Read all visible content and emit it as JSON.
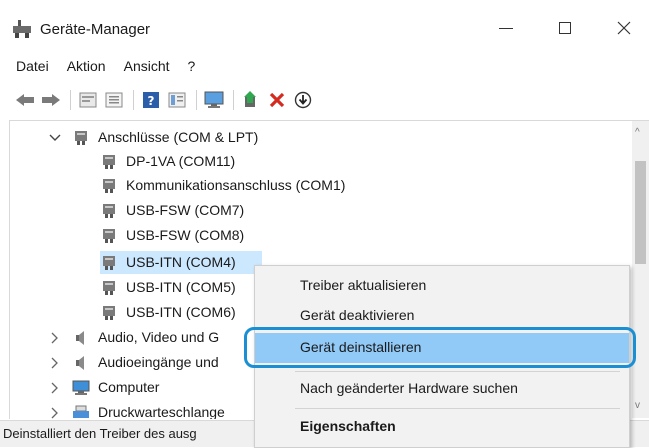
{
  "window": {
    "title": "Geräte-Manager"
  },
  "menu": [
    "Datei",
    "Aktion",
    "Ansicht",
    "?"
  ],
  "toolbar_icons": [
    "back-icon",
    "forward-icon",
    "properties-icon",
    "list-icon",
    "help-icon",
    "view-icon",
    "monitor-icon",
    "update-driver-icon",
    "uninstall-icon",
    "disable-icon"
  ],
  "tree": {
    "category_expanded": "Anschlüsse (COM & LPT)",
    "children": [
      "DP-1VA (COM11)",
      "Kommunikationsanschluss (COM1)",
      "USB-FSW (COM7)",
      "USB-FSW (COM8)",
      "USB-ITN (COM4)",
      "USB-ITN (COM5)",
      "USB-ITN (COM6)"
    ],
    "collapsed_categories": [
      "Audio, Video und G",
      "Audioeingänge und",
      "Computer",
      "Druckwarteschlange"
    ]
  },
  "context_menu": {
    "items": [
      "Treiber aktualisieren",
      "Gerät deaktivieren",
      "Gerät deinstallieren",
      "Nach geänderter Hardware suchen",
      "Eigenschaften"
    ],
    "highlighted": "Gerät deinstallieren"
  },
  "status": "Deinstalliert den Treiber des ausg",
  "colors": {
    "highlight": "#91c9f7",
    "focus_ring": "#1b8fd3",
    "selection": "#cce8ff"
  }
}
